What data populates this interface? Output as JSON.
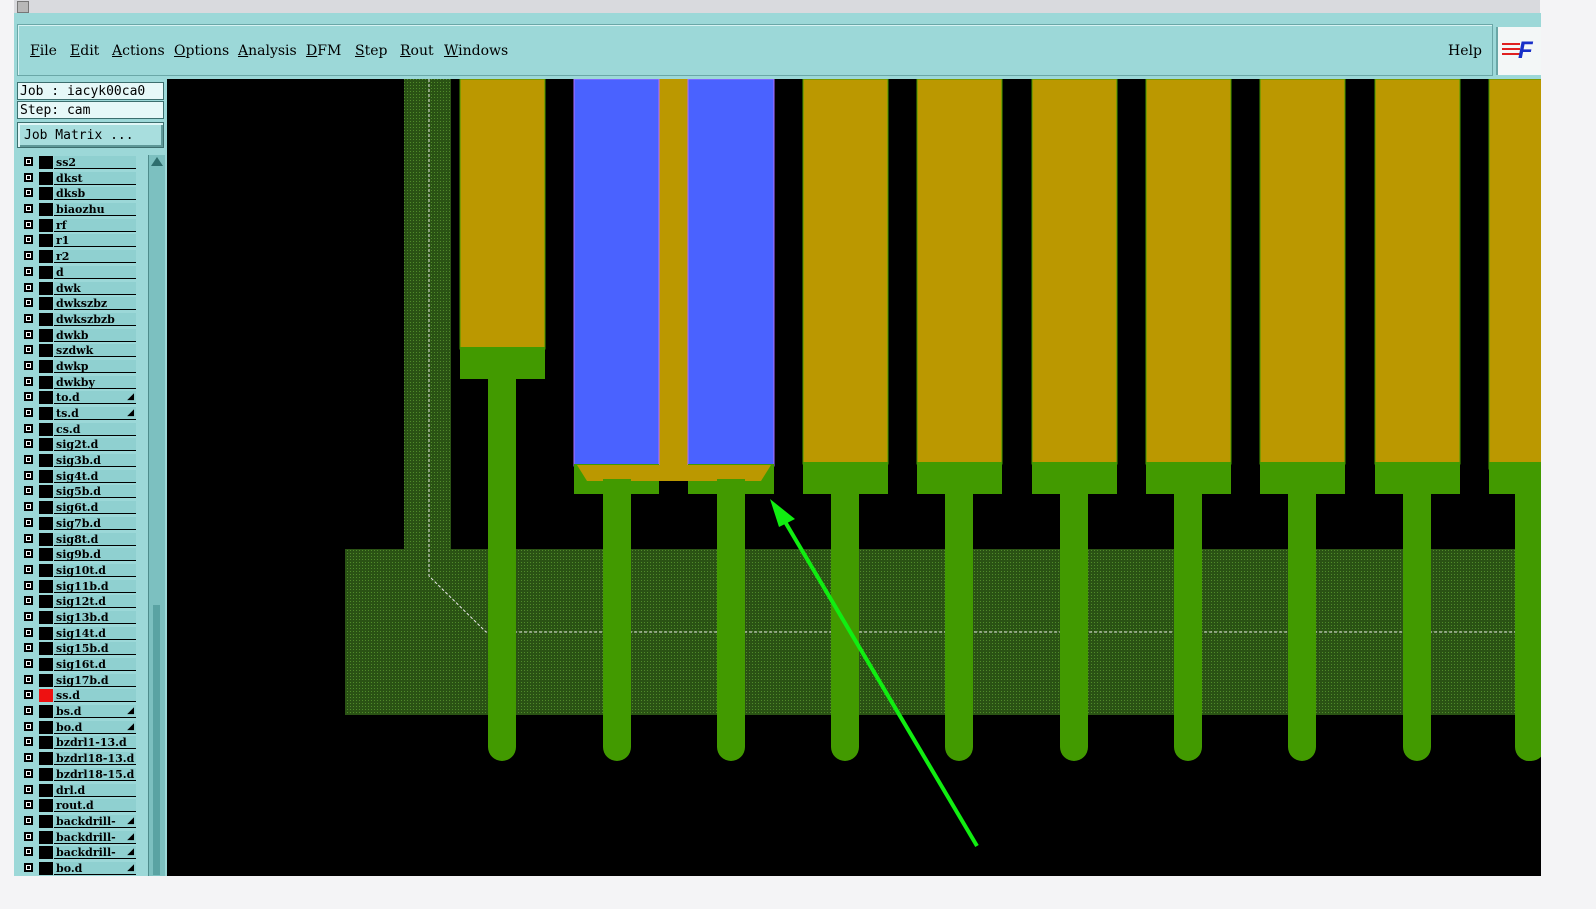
{
  "menu": {
    "items": [
      {
        "label": "File",
        "underline": "F",
        "rest": "ile"
      },
      {
        "label": "Edit",
        "underline": "E",
        "rest": "dit"
      },
      {
        "label": "Actions",
        "underline": "A",
        "rest": "ctions"
      },
      {
        "label": "Options",
        "underline": "O",
        "rest": "ptions"
      },
      {
        "label": "Analysis",
        "underline": "A",
        "rest": "nalysis"
      },
      {
        "label": "DFM",
        "underline": "D",
        "rest": "FM"
      },
      {
        "label": "Step",
        "underline": "S",
        "rest": "tep"
      },
      {
        "label": "Rout",
        "underline": "R",
        "rest": "out"
      },
      {
        "label": "Windows",
        "underline": "W",
        "rest": "indows"
      }
    ],
    "help": "Help",
    "logo_text": "F"
  },
  "panel": {
    "job": "Job : iacyk00ca0",
    "step": "Step: cam",
    "job_matrix": "Job Matrix ...",
    "active_layer": "ss.d",
    "active_color": "#ee1111",
    "layers": [
      "ss2",
      "dkst",
      "dksb",
      "biaozhu",
      "rf",
      "r1",
      "r2",
      "d",
      "dwk",
      "dwkszbz",
      "dwkszbzb",
      "dwkb",
      "szdwk",
      "dwkp",
      "dwkby",
      "to.d",
      "ts.d",
      "cs.d",
      "sig2t.d",
      "sig3b.d",
      "sig4t.d",
      "sig5b.d",
      "sig6t.d",
      "sig7b.d",
      "sig8t.d",
      "sig9b.d",
      "sig10t.d",
      "sig11b.d",
      "sig12t.d",
      "sig13b.d",
      "sig14t.d",
      "sig15b.d",
      "sig16t.d",
      "sig17b.d",
      "ss.d",
      "bs.d",
      "bo.d",
      "bzdrl1-13.d",
      "bzdrl18-13.d",
      "bzdrl18-15.d",
      "drl.d",
      "rout.d",
      "backdrill-",
      "backdrill-",
      "backdrill-",
      "bo.d"
    ],
    "layers_with_icon": [
      "to.d",
      "ts.d",
      "bs.d",
      "bo.d",
      "backdrill-"
    ]
  },
  "canvas": {
    "colors": {
      "background": "#000000",
      "pad": "#bb9800",
      "trace": "#429a00",
      "mask": "#2f5a17",
      "selected": "#4a62ff",
      "arrow": "#11ee11"
    }
  }
}
